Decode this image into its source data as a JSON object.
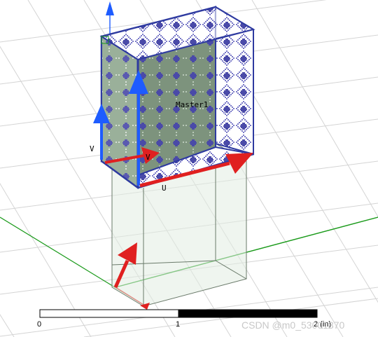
{
  "viewport": {
    "labels": {
      "master": "Master1",
      "v_axis": "V",
      "v_axis_2": "V",
      "u_axis": "U"
    },
    "scale_bar": {
      "tick_0": "0",
      "tick_1": "1",
      "tick_2": "2 (in)"
    },
    "watermark": "CSDN @m0_53001370",
    "colors": {
      "pattern_dark": "#4a4aa8",
      "pattern_light": "#9a9ad8",
      "edge_blue": "#2e3aa0",
      "arrow_red": "#e02020",
      "arrow_blue": "#1e5cff",
      "axis_green": "#1a9a1a"
    }
  }
}
